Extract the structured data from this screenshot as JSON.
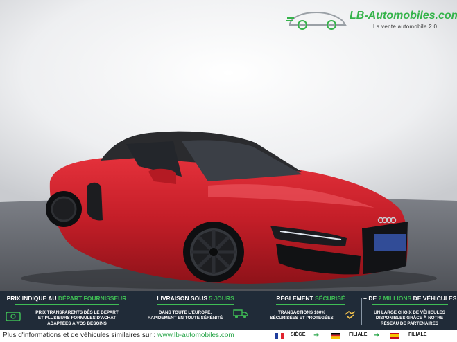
{
  "logo": {
    "brand": "LB-Automobiles.com",
    "tagline": "La vente automobile 2.0"
  },
  "banner": {
    "col1": {
      "title_pre": "PRIX INDIQUE AU ",
      "title_hl": "DÉPART FOURNISSEUR",
      "line1": "PRIX TRANSPARENTS DÈS LE DEPART",
      "line2": "ET PLUSIEURS FORMULES D'ACHAT",
      "line3": "ADAPTÉES À VOS BESOINS"
    },
    "col2": {
      "title_pre": "LIVRAISON SOUS ",
      "title_hl": "5 JOURS",
      "line1": "DANS TOUTE L'EUROPE,",
      "line2": "RAPIDEMENT EN TOUTE SÉRÉNITÉ"
    },
    "col3": {
      "title_pre": "RÈGLEMENT ",
      "title_hl": "SÉCURISÉ",
      "line1": "TRANSACTIONS 100%",
      "line2": "SÉCURISÉES ET PROTÉGÉES"
    },
    "col4": {
      "title_pre": "+ DE ",
      "title_hl": "2 MILLIONS",
      "title_post": " DE VÉHICULES",
      "line1": "UN LARGE CHOIX DE VÉHICULES",
      "line2": "DISPONIBLES GRÂCE À NOTRE",
      "line3": "RÉSEAU DE PARTENAIRES"
    }
  },
  "footer": {
    "text": "Plus d'informations et de véhicules similaires sur : ",
    "link": "www.lb-automobiles.com",
    "label1": "SIÈGE",
    "label2": "FILIALE",
    "label3": "FILIALE"
  },
  "colors": {
    "accent": "#3fbd55",
    "banner_bg": "#202b38",
    "car_red": "#c8202c"
  }
}
